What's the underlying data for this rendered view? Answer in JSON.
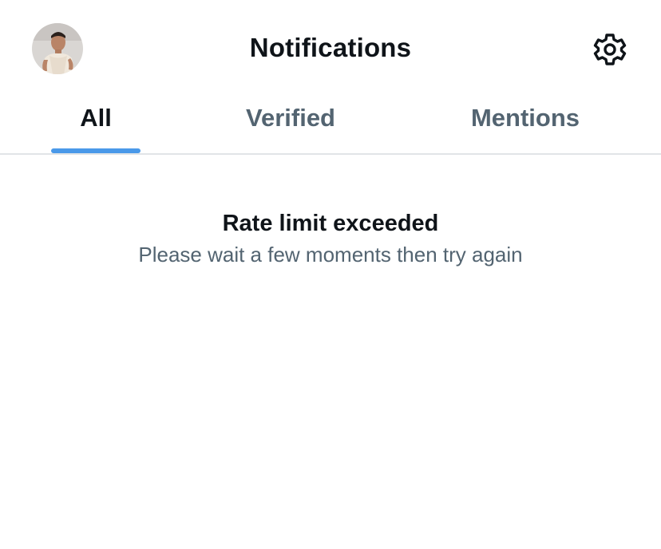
{
  "header": {
    "title": "Notifications",
    "avatar_icon": "profile-avatar",
    "settings_icon": "gear-icon"
  },
  "tabs": [
    {
      "label": "All",
      "active": true
    },
    {
      "label": "Verified",
      "active": false
    },
    {
      "label": "Mentions",
      "active": false
    }
  ],
  "error": {
    "title": "Rate limit exceeded",
    "message": "Please wait a few moments then try again"
  },
  "colors": {
    "text_primary": "#0f1419",
    "text_secondary": "#536471",
    "accent": "#4a99e9",
    "divider": "#e1e4e7",
    "background": "#ffffff"
  }
}
